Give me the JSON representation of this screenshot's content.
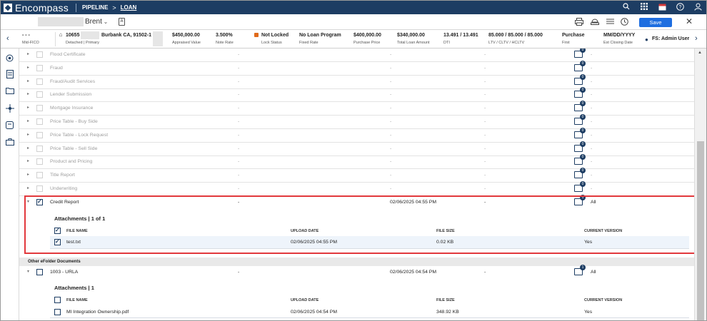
{
  "app": {
    "brand": "Encompass",
    "crumb_pipeline": "PIPELINE",
    "crumb_arrow": ">",
    "crumb_loan": "LOAN"
  },
  "header": {
    "borrower": "Brent",
    "save": "Save",
    "close": "✕"
  },
  "loan_info": [
    {
      "value": "- - -",
      "label": "Mid-FICO"
    },
    {
      "value": "10655",
      "label": "Detached | Primary"
    },
    {
      "value": "Burbank CA, 91502-1",
      "label": ""
    },
    {
      "value": "$450,000.00",
      "label": "Appraised Value"
    },
    {
      "value": "3.500%",
      "label": "Note Rate"
    },
    {
      "value": "Not Locked",
      "label": "Lock Status"
    },
    {
      "value": "No Loan Program",
      "label": "Fixed Rate"
    },
    {
      "value": "$400,000.00",
      "label": "Purchase Price"
    },
    {
      "value": "$340,000.00",
      "label": "Total Loan Amount"
    },
    {
      "value": "13.491 / 13.491",
      "label": "DTI"
    },
    {
      "value": "85.000 / 85.000 / 85.000",
      "label": "LTV / CLTV / HCLTV"
    },
    {
      "value": "Purchase",
      "label": "First"
    },
    {
      "value": "MM/DD/YYYY",
      "label": "Est Closing Date"
    },
    {
      "value": "FS: Admin User",
      "label": ""
    }
  ],
  "dim_rows": [
    {
      "name": "Flood Certificate",
      "c2": "-",
      "c3": "-",
      "c4": "-",
      "badge": "0",
      "c6": "-"
    },
    {
      "name": "Fraud",
      "c2": "-",
      "c3": "-",
      "c4": "-",
      "badge": "0",
      "c6": "-"
    },
    {
      "name": "Fraud/Audit Services",
      "c2": "-",
      "c3": "-",
      "c4": "-",
      "badge": "0",
      "c6": "-"
    },
    {
      "name": "Lender Submission",
      "c2": "-",
      "c3": "-",
      "c4": "-",
      "badge": "0",
      "c6": "-"
    },
    {
      "name": "Mortgage Insurance",
      "c2": "-",
      "c3": "-",
      "c4": "-",
      "badge": "0",
      "c6": "-"
    },
    {
      "name": "Price Table - Buy Side",
      "c2": "-",
      "c3": "-",
      "c4": "-",
      "badge": "0",
      "c6": "-"
    },
    {
      "name": "Price Table - Lock Request",
      "c2": "-",
      "c3": "-",
      "c4": "-",
      "badge": "0",
      "c6": "-"
    },
    {
      "name": "Price Table - Sell Side",
      "c2": "-",
      "c3": "-",
      "c4": "-",
      "badge": "0",
      "c6": "-"
    },
    {
      "name": "Product and Pricing",
      "c2": "-",
      "c3": "-",
      "c4": "-",
      "badge": "0",
      "c6": "-"
    },
    {
      "name": "Title Report",
      "c2": "-",
      "c3": "-",
      "c4": "-",
      "badge": "0",
      "c6": "-"
    },
    {
      "name": "Underwriting",
      "c2": "-",
      "c3": "-",
      "c4": "-",
      "badge": "0",
      "c6": "-"
    }
  ],
  "credit_report": {
    "name": "Credit Report",
    "c2": "-",
    "date": "02/06/2025 04:55 PM",
    "c4": "-",
    "badge": "1",
    "scope": "All",
    "attachments_title": "Attachments | 1 of 1",
    "headers": [
      "FILE NAME",
      "UPLOAD DATE",
      "FILE SIZE",
      "CURRENT VERSION"
    ],
    "file": {
      "name": "test.txt",
      "date": "02/06/2025 04:55 PM",
      "size": "0.02 KB",
      "version": "Yes"
    }
  },
  "other_section": "Other eFolder Documents",
  "urla": {
    "name": "1003 - URLA",
    "c2": "-",
    "date": "02/06/2025 04:54 PM",
    "c4": "-",
    "badge": "1",
    "scope": "All",
    "attachments_title": "Attachments | 1",
    "headers": [
      "FILE NAME",
      "UPLOAD DATE",
      "FILE SIZE",
      "CURRENT VERSION"
    ],
    "file": {
      "name": "MI Integration Ownership.pdf",
      "date": "02/06/2025 04:54 PM",
      "size": "348.92 KB",
      "version": "Yes"
    }
  },
  "icons": [
    "search-icon",
    "apps-grid-icon",
    "calendar-icon",
    "help-icon",
    "user-icon",
    "print-icon",
    "lock-desk-icon",
    "list-icon",
    "clock-icon"
  ],
  "colors": {
    "topbar": "#1d3d63",
    "save": "#1e6ee0",
    "highlight": "#e2383c",
    "lock": "#e06a1b"
  }
}
